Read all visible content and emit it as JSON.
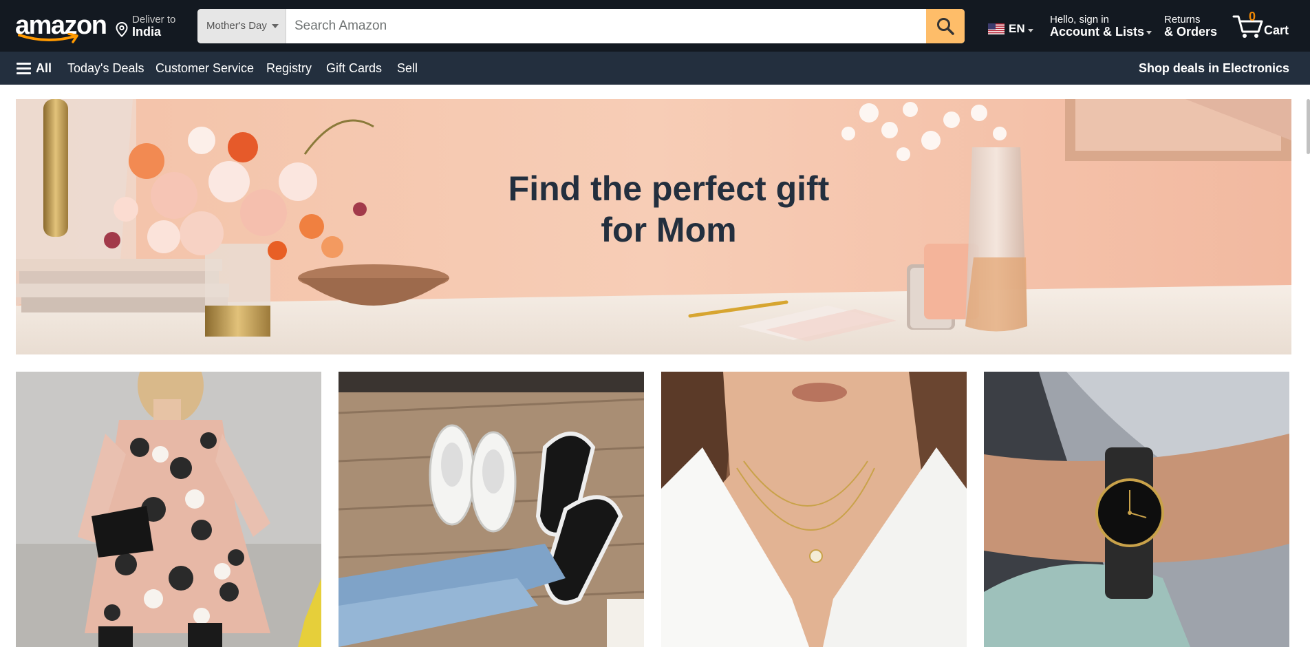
{
  "header": {
    "logo_text": "amazon",
    "deliver_line1": "Deliver to",
    "deliver_line2": "India",
    "search_category": "Mother's Day",
    "search_placeholder": "Search Amazon",
    "language_code": "EN",
    "account_line1": "Hello, sign in",
    "account_line2": "Account & Lists",
    "returns_line1": "Returns",
    "returns_line2": "& Orders",
    "cart_count": "0",
    "cart_label": "Cart"
  },
  "subnav": {
    "all_label": "All",
    "items": [
      "Today's Deals",
      "Customer Service",
      "Registry",
      "Gift Cards",
      "Sell"
    ],
    "promo": "Shop deals in Electronics"
  },
  "hero": {
    "title_line1": "Find the perfect gift",
    "title_line2": "for Mom"
  },
  "products": [
    {
      "name": "floral-dress-image"
    },
    {
      "name": "slip-on-shoes-image"
    },
    {
      "name": "gold-necklace-image"
    },
    {
      "name": "black-watch-image"
    }
  ],
  "colors": {
    "nav_top": "#131921",
    "nav_sub": "#232f3e",
    "search_button": "#febd69",
    "cart_count": "#f08804",
    "hero_background": "#f6c9b1"
  }
}
